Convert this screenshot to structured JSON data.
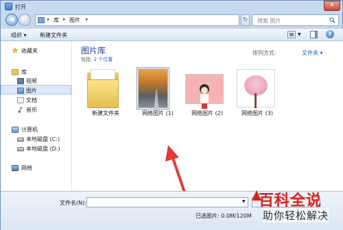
{
  "window": {
    "title": "打开",
    "close_glyph": "✕"
  },
  "navigation": {
    "back_glyph": "◀",
    "forward_glyph": "▶",
    "breadcrumbs": [
      "库",
      "图片"
    ],
    "refresh_glyph": "↻",
    "search_placeholder": "搜索 图片"
  },
  "toolbar": {
    "organize_label": "组织 ▾",
    "new_folder_label": "新建文件夹",
    "help_glyph": "?"
  },
  "sidebar": {
    "items": [
      {
        "label": "收藏夹",
        "icon": "star-icon",
        "indent": false
      },
      {
        "label": "库",
        "icon": "library-icon",
        "indent": false
      },
      {
        "label": "视频",
        "icon": "video-icon",
        "indent": true
      },
      {
        "label": "图片",
        "icon": "pictures-icon",
        "indent": true,
        "selected": true
      },
      {
        "label": "文档",
        "icon": "documents-icon",
        "indent": true
      },
      {
        "label": "音乐",
        "icon": "music-icon",
        "indent": true
      },
      {
        "label": "计算机",
        "icon": "computer-icon",
        "indent": false
      },
      {
        "label": "本地磁盘 (C:)",
        "icon": "drive-icon",
        "indent": true
      },
      {
        "label": "本地磁盘 (D:)",
        "icon": "drive-icon",
        "indent": true
      },
      {
        "label": "网络",
        "icon": "network-icon",
        "indent": false
      }
    ]
  },
  "library": {
    "title": "图片库",
    "includes_label": "包括:",
    "includes_link": "2 个位置",
    "arrange_label": "排列方式:",
    "arrange_value": "文件夹 ▾"
  },
  "files": [
    {
      "name": "新建文件夹",
      "type": "folder"
    },
    {
      "name": "网络图片 (1)",
      "type": "image"
    },
    {
      "name": "网络图片 (2)",
      "type": "image"
    },
    {
      "name": "网络图片 (3)",
      "type": "image"
    }
  ],
  "bottom": {
    "filename_label": "文件名(N):",
    "filename_value": "",
    "status_text": "已选图片: 0.0M/120M"
  },
  "watermark": {
    "main": "百科全说",
    "sub": "助你轻松解决"
  },
  "colors": {
    "accent_link": "#1565c0",
    "arrow_red": "#e53935",
    "watermark_red": "#d91f1f"
  }
}
